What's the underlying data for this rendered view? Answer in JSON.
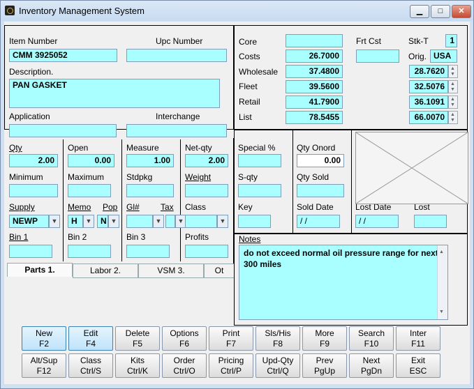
{
  "window": {
    "title": "Inventory Management System",
    "min": "▁",
    "max": "□",
    "close": "✕"
  },
  "part": {
    "item_number_label": "Item Number",
    "item_number": "CMM 3925052",
    "upc_label": "Upc  Number",
    "upc": "",
    "description_label": "Description.",
    "description": "PAN GASKET",
    "application_label": "Application",
    "application": "",
    "interchange_label": "Interchange",
    "interchange": ""
  },
  "pricing": {
    "core_label": "Core",
    "core": "",
    "frt_cst_label": "Frt Cst",
    "frt_cst": "",
    "stk_t_label": "Stk-T",
    "stk_t": "1",
    "costs_label": "Costs",
    "costs": "26.7000",
    "orig_label": "Orig.",
    "orig": "USA",
    "wholesale_label": "Wholesale",
    "wholesale": "37.4800",
    "wholesale_pct": "28.7620",
    "fleet_label": "Fleet",
    "fleet": "39.5600",
    "fleet_pct": "32.5076",
    "retail_label": "Retail",
    "retail": "41.7900",
    "retail_pct": "36.1091",
    "list_label": "List",
    "list": "78.5455",
    "list_pct": "66.0070"
  },
  "stock": {
    "qty_label": "Qty",
    "qty": "2.00",
    "open_label": "Open",
    "open": "0.00",
    "measure_label": "Measure",
    "measure": "1.00",
    "net_qty_label": "Net-qty",
    "net_qty": "2.00",
    "minimum_label": "Minimum",
    "minimum": "",
    "maximum_label": "Maximum",
    "maximum": "",
    "stdpkg_label": "Stdpkg",
    "stdpkg": "",
    "weight_label": "Weight",
    "weight": "",
    "supply_label": "Supply",
    "supply": "NEWP",
    "memo_label": "Memo",
    "memo": "H",
    "pop_label": "Pop",
    "pop": "N",
    "gl_label": "Gl#",
    "gl": "",
    "tax_label": "Tax",
    "tax": "",
    "class_label": "Class",
    "class": "",
    "bin1_label": "Bin 1",
    "bin1": "",
    "bin2_label": "Bin 2",
    "bin2": "",
    "bin3_label": "Bin 3",
    "bin3": "",
    "profits_label": "Profits",
    "profits": ""
  },
  "special": {
    "special_pct_label": "Special %",
    "special_pct": "",
    "qty_onord_label": "Qty Onord",
    "qty_onord": "0.00",
    "s_qty_label": "S-qty",
    "s_qty": "",
    "qty_sold_label": "Qty Sold",
    "qty_sold": "",
    "key_label": "Key",
    "key": "",
    "sold_date_label": "Sold Date",
    "sold_date": " / /",
    "lost_date_label": "Lost Date",
    "lost_date": " / /",
    "lost_label": "Lost",
    "lost": ""
  },
  "notes": {
    "label": "Notes",
    "text": "do not exceed normal oil pressure range for next 300 miles"
  },
  "tabs": [
    {
      "label": "Parts 1."
    },
    {
      "label": "Labor 2."
    },
    {
      "label": "VSM 3."
    },
    {
      "label": "Ot"
    }
  ],
  "buttons_row1": [
    {
      "top": "New",
      "bottom": "F2"
    },
    {
      "top": "Edit",
      "bottom": "F4"
    },
    {
      "top": "Delete",
      "bottom": "F5"
    },
    {
      "top": "Options",
      "bottom": "F6"
    },
    {
      "top": "Print",
      "bottom": "F7"
    },
    {
      "top": "Sls/His",
      "bottom": "F8"
    },
    {
      "top": "More",
      "bottom": "F9"
    },
    {
      "top": "Search",
      "bottom": "F10"
    },
    {
      "top": "Inter",
      "bottom": "F11"
    }
  ],
  "buttons_row2": [
    {
      "top": "Alt/Sup",
      "bottom": "F12"
    },
    {
      "top": "Class",
      "bottom": "Ctrl/S"
    },
    {
      "top": "Kits",
      "bottom": "Ctrl/K"
    },
    {
      "top": "Order",
      "bottom": "Ctrl/O"
    },
    {
      "top": "Pricing",
      "bottom": "Ctrl/P"
    },
    {
      "top": "Upd-Qty",
      "bottom": "Ctrl/Q"
    },
    {
      "top": "Prev",
      "bottom": "PgUp"
    },
    {
      "top": "Next",
      "bottom": "PgDn"
    },
    {
      "top": "Exit",
      "bottom": "ESC"
    }
  ]
}
